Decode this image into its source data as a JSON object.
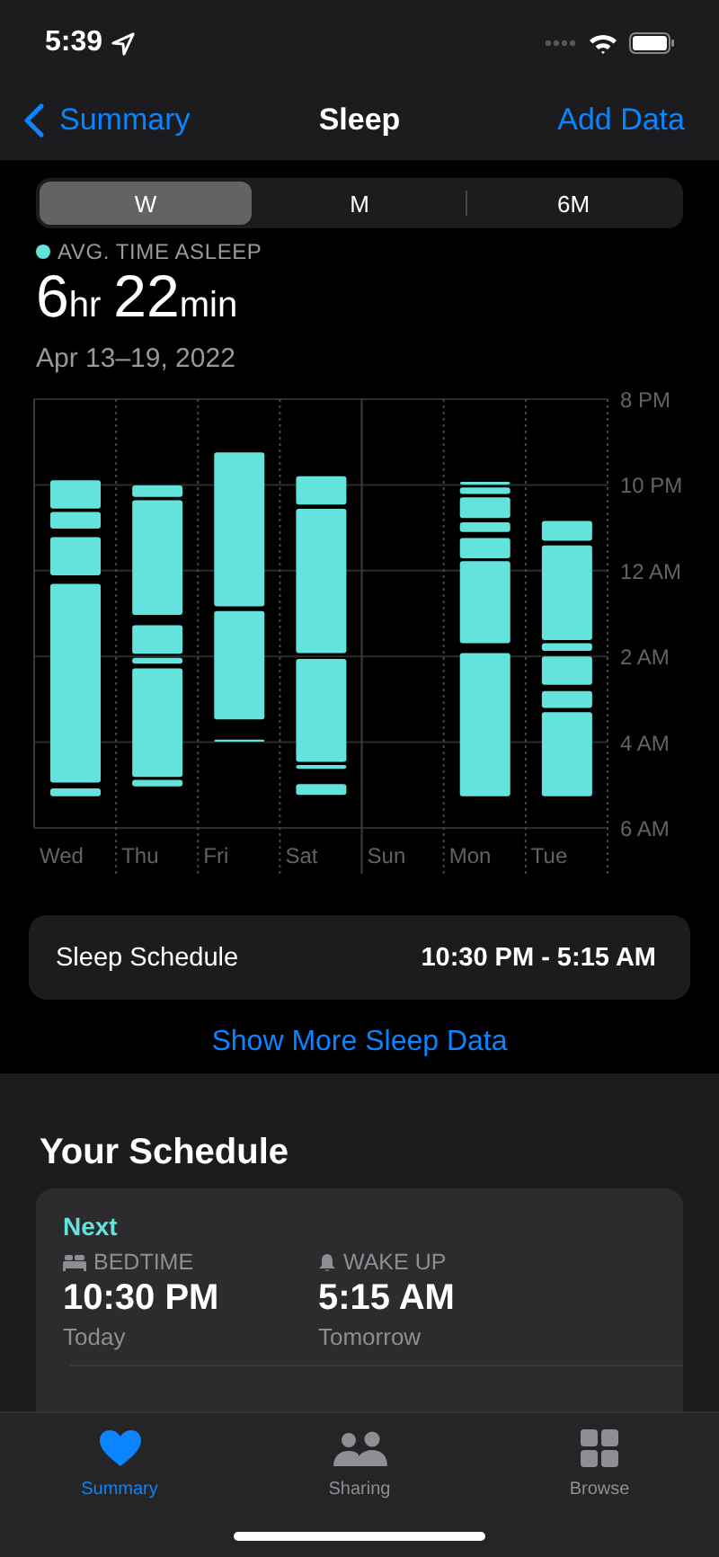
{
  "status_bar": {
    "time": "5:39"
  },
  "nav": {
    "back": "Summary",
    "title": "Sleep",
    "action": "Add Data"
  },
  "segments": [
    {
      "label": "W",
      "selected": true
    },
    {
      "label": "M",
      "selected": false
    },
    {
      "label": "6M",
      "selected": false
    }
  ],
  "summary": {
    "legend": "AVG. TIME ASLEEP",
    "value_parts": [
      {
        "text": "6",
        "kind": "number"
      },
      {
        "text": "hr",
        "kind": "unit"
      },
      {
        "text": "22",
        "kind": "number"
      },
      {
        "text": "min",
        "kind": "unit"
      }
    ],
    "date_range": "Apr 13–19, 2022"
  },
  "chart": {
    "time_labels": [
      "8 PM",
      "10 PM",
      "12 AM",
      "2 AM",
      "4 AM",
      "6 AM"
    ],
    "day_labels": [
      "Wed",
      "Thu",
      "Fri",
      "Sat",
      "Sun",
      "Mon",
      "Tue"
    ]
  },
  "schedule_row": {
    "label": "Sleep Schedule",
    "value": "10:30 PM - 5:15 AM"
  },
  "more_link": "Show More Sleep Data",
  "your_schedule": {
    "title": "Your Schedule",
    "card": {
      "tag": "Next",
      "items": [
        {
          "kind": "bedtime",
          "label": "BEDTIME",
          "time": "10:30 PM",
          "day": "Today"
        },
        {
          "kind": "wake",
          "label": "WAKE UP",
          "time": "5:15 AM",
          "day": "Tomorrow"
        }
      ]
    }
  },
  "tab_bar": [
    {
      "kind": "heart",
      "label": "Summary",
      "selected": true
    },
    {
      "kind": "people",
      "label": "Sharing",
      "selected": false
    },
    {
      "kind": "grid",
      "label": "Browse",
      "selected": false
    }
  ]
}
